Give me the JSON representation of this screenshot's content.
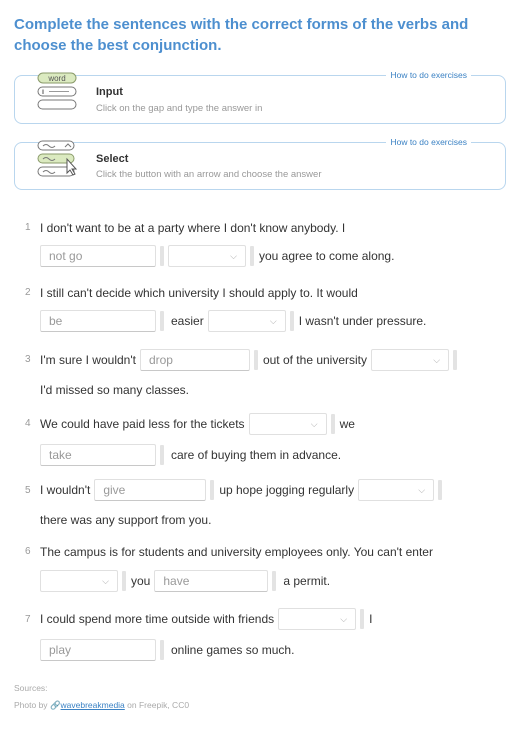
{
  "title": "Complete the sentences with the correct forms of the verbs and choose the best conjunction.",
  "hints": [
    {
      "title": "Input",
      "desc": "Click on the gap and type the answer in",
      "howto": "How to do exercises",
      "icon_word": "word"
    },
    {
      "title": "Select",
      "desc": "Click the button with an arrow and choose the answer",
      "howto": "How to do exercises"
    }
  ],
  "exercises": {
    "e1": {
      "num": "1",
      "a": "I don't want to be at a party where I don't know anybody. I",
      "gap": "not go",
      "b": "you agree to come along."
    },
    "e2": {
      "num": "2",
      "a": "I still can't decide which university I should apply to. It would",
      "gap": "be",
      "b": "easier",
      "c": "I wasn't under pressure."
    },
    "e3": {
      "num": "3",
      "a": "I'm sure I wouldn't",
      "gap": "drop",
      "b": "out of the university",
      "c": "I'd missed so many classes."
    },
    "e4": {
      "num": "4",
      "a": "We could have paid less for the tickets",
      "b": "we",
      "gap": "take",
      "c": "care of buying them in advance."
    },
    "e5": {
      "num": "5",
      "a": "I wouldn't",
      "gap": "give",
      "b": "up hope jogging regularly",
      "c": "there was any support from you."
    },
    "e6": {
      "num": "6",
      "a": "The campus is for students and university employees only. You can't enter",
      "b": "you",
      "gap": "have",
      "c": "a permit."
    },
    "e7": {
      "num": "7",
      "a": "I could spend more time outside with friends",
      "b": "I",
      "gap": "play",
      "c": "online games so much."
    }
  },
  "footer": {
    "sources": "Sources:",
    "photo_by": "Photo by",
    "author": "wavebreakmedia",
    "on": "on Freepik, CC0"
  },
  "colors": {
    "accent": "#4d8fcf",
    "border": "#b9d6ee",
    "link": "#3b82c4"
  }
}
